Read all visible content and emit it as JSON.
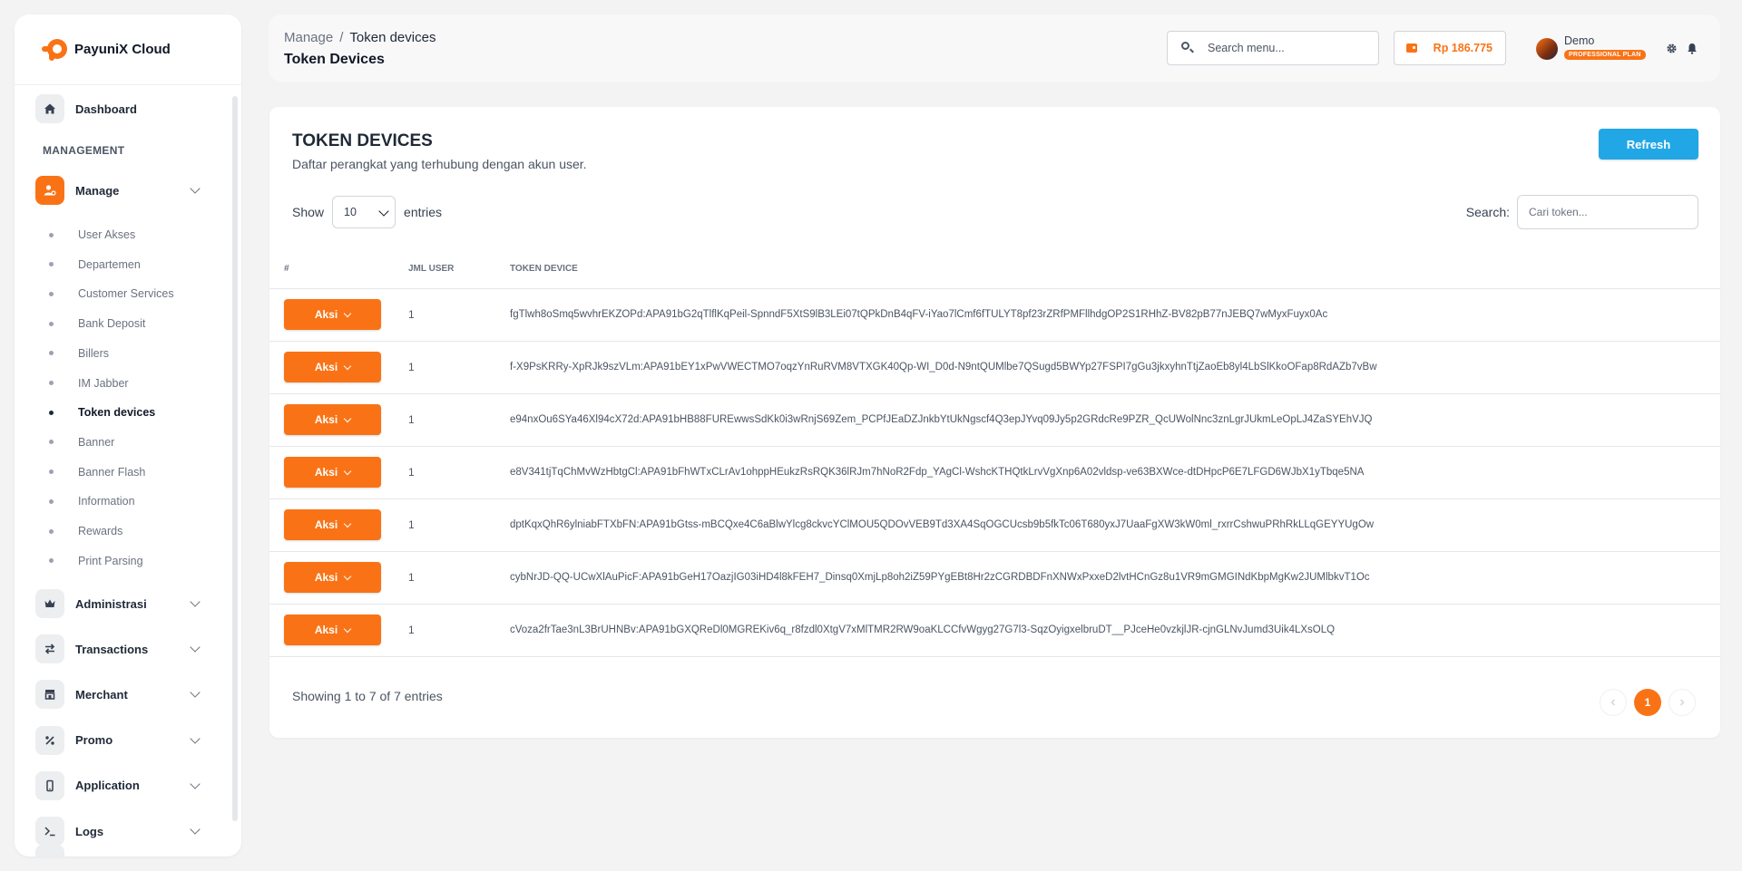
{
  "brand": {
    "name": "PayuniX Cloud"
  },
  "sidebar": {
    "dashboard": "Dashboard",
    "section": "MANAGEMENT",
    "manage": "Manage",
    "sub_items": [
      "User Akses",
      "Departemen",
      "Customer Services",
      "Bank Deposit",
      "Billers",
      "IM Jabber",
      "Token devices",
      "Banner",
      "Banner Flash",
      "Information",
      "Rewards",
      "Print Parsing"
    ],
    "active_sub": "Token devices",
    "groups": [
      "Administrasi",
      "Transactions",
      "Merchant",
      "Promo",
      "Application",
      "Logs"
    ]
  },
  "header": {
    "breadcrumb_root": "Manage",
    "breadcrumb_sep": "/",
    "breadcrumb_current": "Token devices",
    "title": "Token Devices",
    "search_placeholder": "Search menu...",
    "balance": "Rp 186.775",
    "user_name": "Demo",
    "plan": "PROFESSIONAL PLAN"
  },
  "card": {
    "title": "TOKEN DEVICES",
    "subtitle": "Daftar perangkat yang terhubung dengan akun user.",
    "refresh": "Refresh",
    "show_label": "Show",
    "show_value": "10",
    "entries_label": "entries",
    "search_label": "Search:",
    "search_placeholder": "Cari token..."
  },
  "table": {
    "headers": [
      "#",
      "JML USER",
      "TOKEN DEVICE"
    ],
    "action_label": "Aksi",
    "rows": [
      {
        "jml": "1",
        "token": "fgTlwh8oSmq5wvhrEKZOPd:APA91bG2qTlflKqPeil-SpnndF5XtS9lB3LEi07tQPkDnB4qFV-iYao7lCmf6fTULYT8pf23rZRfPMFllhdgOP2S1RHhZ-BV82pB77nJEBQ7wMyxFuyx0Ac"
      },
      {
        "jml": "1",
        "token": "f-X9PsKRRy-XpRJk9szVLm:APA91bEY1xPwVWECTMO7oqzYnRuRVM8VTXGK40Qp-WI_D0d-N9ntQUMlbe7QSugd5BWYp27FSPI7gGu3jkxyhnTtjZaoEb8yl4LbSlKkoOFap8RdAZb7vBw"
      },
      {
        "jml": "1",
        "token": "e94nxOu6SYa46Xl94cX72d:APA91bHB88FUREwwsSdKk0i3wRnjS69Zem_PCPfJEaDZJnkbYtUkNgscf4Q3epJYvq09Jy5p2GRdcRe9PZR_QcUWolNnc3znLgrJUkmLeOpLJ4ZaSYEhVJQ"
      },
      {
        "jml": "1",
        "token": "e8V341tjTqChMvWzHbtgCl:APA91bFhWTxCLrAv1ohppHEukzRsRQK36lRJm7hNoR2Fdp_YAgCl-WshcKTHQtkLrvVgXnp6A02vldsp-ve63BXWce-dtDHpcP6E7LFGD6WJbX1yTbqe5NA"
      },
      {
        "jml": "1",
        "token": "dptKqxQhR6ylniabFTXbFN:APA91bGtss-mBCQxe4C6aBlwYlcg8ckvcYClMOU5QDOvVEB9Td3XA4SqOGCUcsb9b5fkTc06T680yxJ7UaaFgXW3kW0ml_rxrrCshwuPRhRkLLqGEYYUgOw"
      },
      {
        "jml": "1",
        "token": "cybNrJD-QQ-UCwXlAuPicF:APA91bGeH17OazjIG03iHD4l8kFEH7_Dinsq0XmjLp8oh2iZ59PYgEBt8Hr2zCGRDBDFnXNWxPxxeD2lvtHCnGz8u1VR9mGMGINdKbpMgKw2JUMlbkvT1Oc"
      },
      {
        "jml": "1",
        "token": "cVoza2frTae3nL3BrUHNBv:APA91bGXQReDl0MGREKiv6q_r8fzdl0XtgV7xMlTMR2RW9oaKLCCfvWgyg27G7l3-SqzOyigxelbruDT__PJceHe0vzkjlJR-cjnGLNvJumd3Uik4LXsOLQ"
      }
    ],
    "showing": "Showing 1 to 7 of 7 entries",
    "page": "1"
  }
}
